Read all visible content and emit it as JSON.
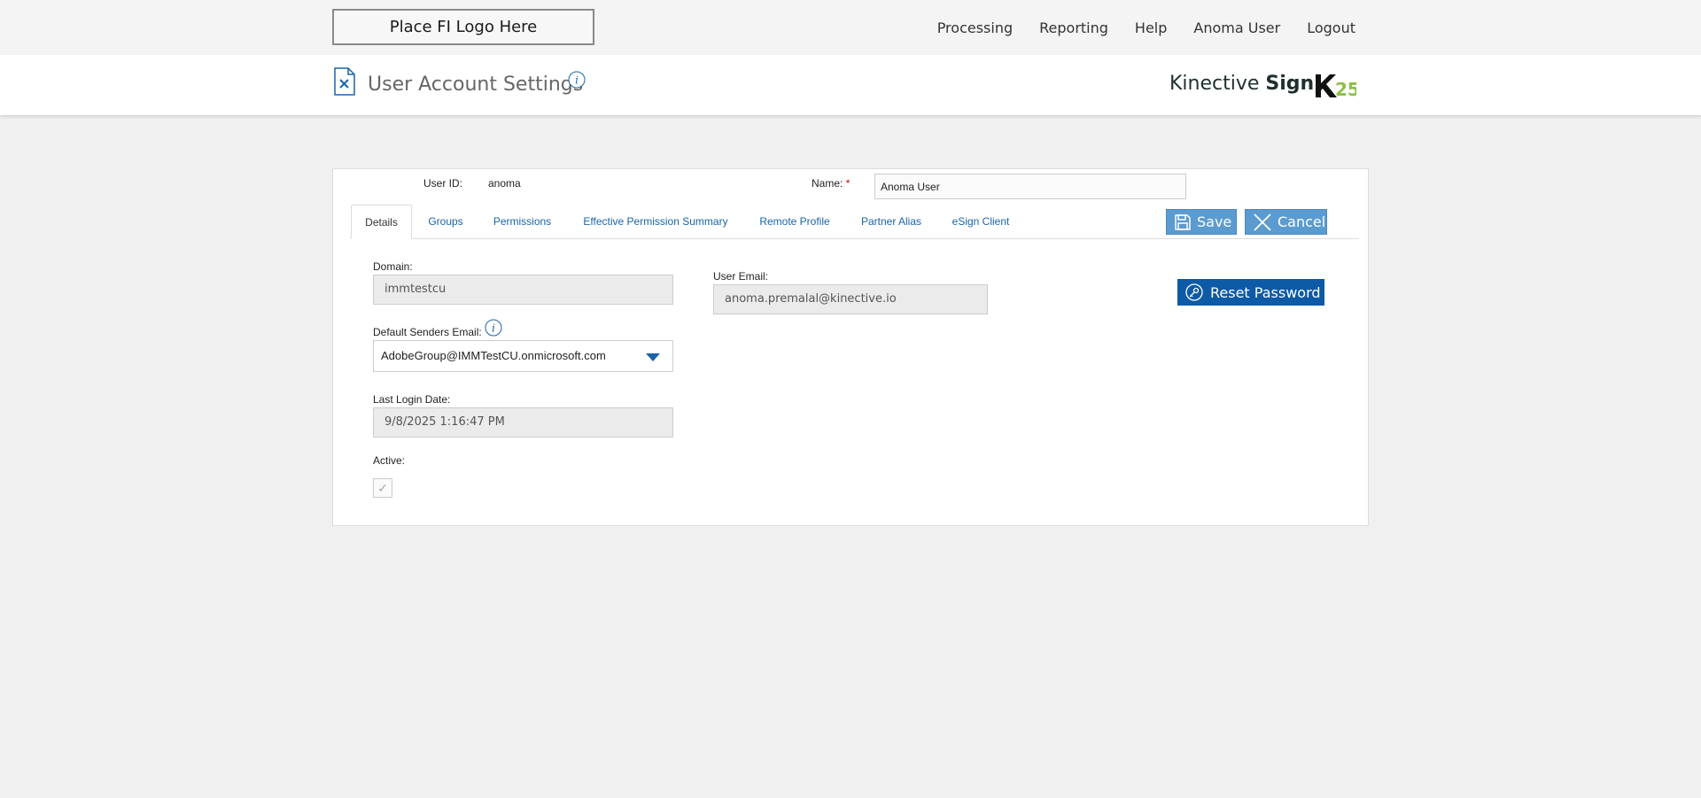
{
  "header": {
    "logo_placeholder": "Place FI Logo Here",
    "nav": [
      "Processing",
      "Reporting",
      "Help",
      "Anoma User",
      "Logout"
    ]
  },
  "titlebar": {
    "title": "User Account Settings",
    "brand_regular": "Kinective",
    "brand_bold": "Sign",
    "brand_mark_icon": "k25-logo-icon"
  },
  "user": {
    "user_id_label": "User ID:",
    "user_id": "anoma",
    "name_label": "Name:",
    "name_required_mark": "*",
    "name_value": "Anoma User"
  },
  "tabs": [
    {
      "label": "Details",
      "active": true
    },
    {
      "label": "Groups",
      "active": false
    },
    {
      "label": "Permissions",
      "active": false
    },
    {
      "label": "Effective Permission Summary",
      "active": false
    },
    {
      "label": "Remote Profile",
      "active": false
    },
    {
      "label": "Partner Alias",
      "active": false
    },
    {
      "label": "eSign Client",
      "active": false
    }
  ],
  "actions": {
    "save": "Save",
    "cancel": "Cancel",
    "reset_password": "Reset Password"
  },
  "details": {
    "domain_label": "Domain:",
    "domain_value": "immtestcu",
    "default_senders_label": "Default Senders Email:",
    "default_senders_value": "AdobeGroup@IMMTestCU.onmicrosoft.com",
    "last_login_label": "Last Login Date:",
    "last_login_value": "9/8/2025 1:16:47 PM",
    "active_label": "Active:",
    "active_checked": true,
    "user_email_label": "User Email:",
    "user_email_value": "anoma.premalal@kinective.io"
  },
  "colors": {
    "accent_blue": "#1a64a8",
    "button_blue": "#5b9bd0",
    "reset_blue": "#0d5aa7",
    "required_red": "#dd0000"
  }
}
